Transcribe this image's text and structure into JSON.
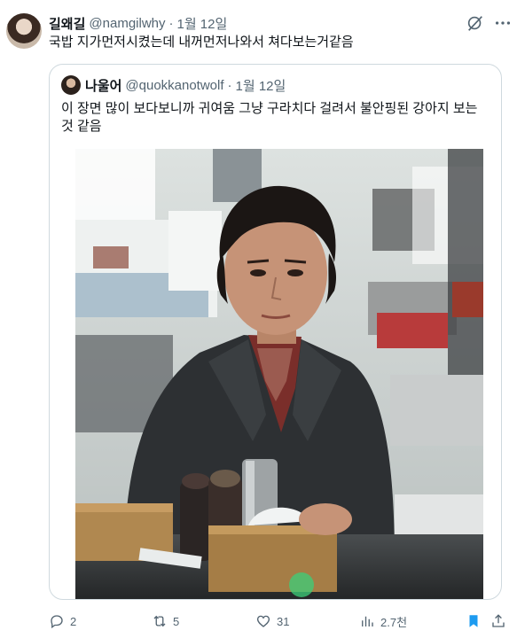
{
  "tweet": {
    "author_name": "길왜길",
    "author_handle": "@namgilwhy",
    "separator": "·",
    "date": "1월 12일",
    "text": "국밥 지가먼저시켰는데 내꺼먼저나와서 쳐다보는거같음"
  },
  "quote": {
    "author_name": "나울어",
    "author_handle": "@quokkanotwolf",
    "separator": "·",
    "date": "1월 12일",
    "text": "이 장면 많이 보다보니까 귀여움 그냥 구라치다 걸려서 불안핑된 강아지 보는 것 같음"
  },
  "actions": {
    "replies": "2",
    "retweets": "5",
    "likes": "31",
    "views": "2.7천"
  },
  "colors": {
    "text_primary": "#0f1419",
    "text_secondary": "#536471",
    "border": "#cfd9de",
    "bookmark_active": "#1d9bf0"
  },
  "icons": [
    "grok-icon",
    "more-icon",
    "reply-icon",
    "retweet-icon",
    "like-icon",
    "views-icon",
    "bookmark-icon",
    "share-icon"
  ]
}
